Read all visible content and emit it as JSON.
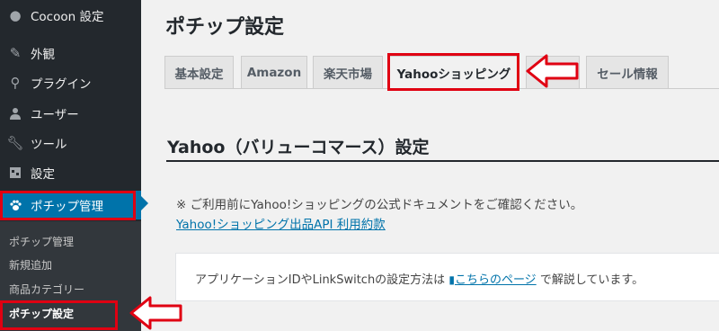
{
  "sidebar": {
    "cocoon": "Cocoon 設定",
    "items": [
      {
        "label": "外観",
        "icon": "brush-icon"
      },
      {
        "label": "プラグイン",
        "icon": "plugin-icon"
      },
      {
        "label": "ユーザー",
        "icon": "user-icon"
      },
      {
        "label": "ツール",
        "icon": "wrench-icon"
      },
      {
        "label": "設定",
        "icon": "settings-icon"
      },
      {
        "label": "ポチップ管理",
        "icon": "paw-icon"
      }
    ],
    "submenu": [
      "ポチップ管理",
      "新規追加",
      "商品カテゴリー",
      "ポチップ設定"
    ]
  },
  "page": {
    "title": "ポチップ設定",
    "tabs": [
      "基本設定",
      "Amazon",
      "楽天市場",
      "Yahooショッピング",
      "セール情報"
    ],
    "active_tab": "Yahooショッピング",
    "section_title": "Yahoo（バリューコマース）設定",
    "notice": "※ ご利用前にYahoo!ショッピングの公式ドキュメントをご確認ください。",
    "doc_link": "Yahoo!ショッピング出品API 利用約款",
    "info_prefix": "アプリケーションIDやLinkSwitchの設定方法は ",
    "info_link": "こちらのページ",
    "info_suffix": " で解説しています。"
  },
  "colors": {
    "sidebar_bg": "#23282d",
    "active_blue": "#0073aa",
    "highlight_red": "#e00012"
  }
}
